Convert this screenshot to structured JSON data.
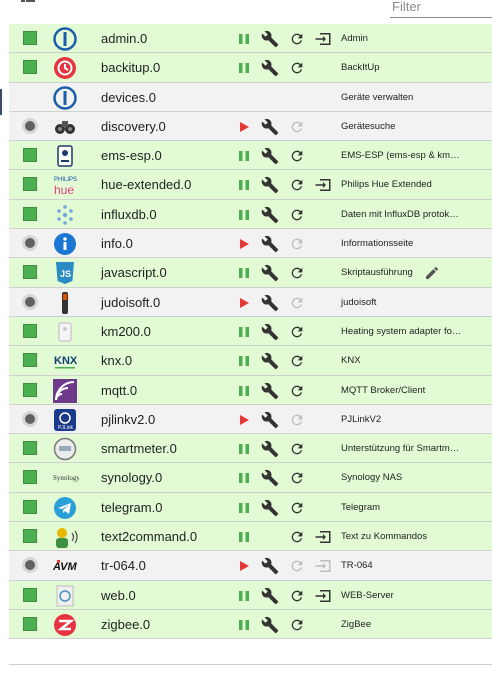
{
  "toolbar": {
    "filter_placeholder": "Filter",
    "icons": [
      "grid-view-icon",
      "list-view-icon",
      "reload-icon",
      "play-icon",
      "more-icon"
    ]
  },
  "colors": {
    "running_row": "#e3fbd5",
    "stopped_row": "#f2f2f2",
    "pause_green": "#4caf50",
    "play_red": "#e53935"
  },
  "adapters": [
    {
      "id": "admin",
      "name": "admin.0",
      "title": "Admin",
      "state": "running",
      "logo": "iobroker-logo",
      "controls": [
        "pause",
        "wrench",
        "reload",
        "open"
      ]
    },
    {
      "id": "backitup",
      "name": "backitup.0",
      "title": "BackItUp",
      "state": "running",
      "logo": "backitup-logo",
      "controls": [
        "pause",
        "wrench",
        "reload"
      ]
    },
    {
      "id": "devices",
      "name": "devices.0",
      "title": "Geräte verwalten",
      "state": "none",
      "logo": "iobroker-logo",
      "controls": []
    },
    {
      "id": "discovery",
      "name": "discovery.0",
      "title": "Gerätesuche",
      "state": "stopped",
      "logo": "binoculars-logo",
      "controls": [
        "play",
        "wrench",
        "reload-disabled"
      ]
    },
    {
      "id": "ems-esp",
      "name": "ems-esp.0",
      "title": "EMS-ESP (ems-esp & km…",
      "state": "running",
      "logo": "ems-esp-logo",
      "controls": [
        "pause",
        "wrench",
        "reload"
      ]
    },
    {
      "id": "hue-extended",
      "name": "hue-extended.0",
      "title": "Philips Hue Extended",
      "state": "running",
      "logo": "philips-hue-logo",
      "controls": [
        "pause",
        "wrench",
        "reload",
        "open"
      ]
    },
    {
      "id": "influxdb",
      "name": "influxdb.0",
      "title": "Daten mit InfluxDB protok…",
      "state": "running",
      "logo": "influxdb-logo",
      "controls": [
        "pause",
        "wrench",
        "reload"
      ]
    },
    {
      "id": "info",
      "name": "info.0",
      "title": "Informationsseite",
      "state": "stopped",
      "logo": "info-logo",
      "controls": [
        "play",
        "wrench",
        "reload-disabled"
      ]
    },
    {
      "id": "javascript",
      "name": "javascript.0",
      "title": "Skriptausführung",
      "state": "running",
      "logo": "javascript-logo",
      "controls": [
        "pause",
        "wrench",
        "reload"
      ],
      "edit": true
    },
    {
      "id": "judoisoft",
      "name": "judoisoft.0",
      "title": "judoisoft",
      "state": "stopped",
      "logo": "judoisoft-logo",
      "controls": [
        "play",
        "wrench",
        "reload-disabled"
      ]
    },
    {
      "id": "km200",
      "name": "km200.0",
      "title": "Heating system adapter fo…",
      "state": "running",
      "logo": "km200-logo",
      "controls": [
        "pause",
        "wrench",
        "reload"
      ]
    },
    {
      "id": "knx",
      "name": "knx.0",
      "title": "KNX",
      "state": "running",
      "logo": "knx-logo",
      "controls": [
        "pause",
        "wrench",
        "reload"
      ]
    },
    {
      "id": "mqtt",
      "name": "mqtt.0",
      "title": "MQTT Broker/Client",
      "state": "running",
      "logo": "mqtt-logo",
      "controls": [
        "pause",
        "wrench",
        "reload"
      ]
    },
    {
      "id": "pjlinkv2",
      "name": "pjlinkv2.0",
      "title": "PJLinkV2",
      "state": "stopped",
      "logo": "pjlink-logo",
      "controls": [
        "play",
        "wrench",
        "reload-disabled"
      ]
    },
    {
      "id": "smartmeter",
      "name": "smartmeter.0",
      "title": "Unterstützung für Smartm…",
      "state": "running",
      "logo": "smartmeter-logo",
      "controls": [
        "pause",
        "wrench",
        "reload"
      ]
    },
    {
      "id": "synology",
      "name": "synology.0",
      "title": "Synology NAS",
      "state": "running",
      "logo": "synology-logo",
      "controls": [
        "pause",
        "wrench",
        "reload"
      ]
    },
    {
      "id": "telegram",
      "name": "telegram.0",
      "title": "Telegram",
      "state": "running",
      "logo": "telegram-logo",
      "controls": [
        "pause",
        "wrench",
        "reload"
      ]
    },
    {
      "id": "text2command",
      "name": "text2command.0",
      "title": "Text zu Kommandos",
      "state": "running",
      "logo": "text2command-logo",
      "controls": [
        "pause",
        "reload",
        "open"
      ]
    },
    {
      "id": "tr-064",
      "name": "tr-064.0",
      "title": "TR-064",
      "state": "stopped",
      "logo": "avm-logo",
      "controls": [
        "play",
        "wrench",
        "reload-disabled",
        "open-disabled"
      ]
    },
    {
      "id": "web",
      "name": "web.0",
      "title": "WEB-Server",
      "state": "running",
      "logo": "web-logo",
      "controls": [
        "pause",
        "wrench",
        "reload",
        "open"
      ]
    },
    {
      "id": "zigbee",
      "name": "zigbee.0",
      "title": "ZigBee",
      "state": "running",
      "logo": "zigbee-logo",
      "controls": [
        "pause",
        "wrench",
        "reload"
      ]
    }
  ]
}
